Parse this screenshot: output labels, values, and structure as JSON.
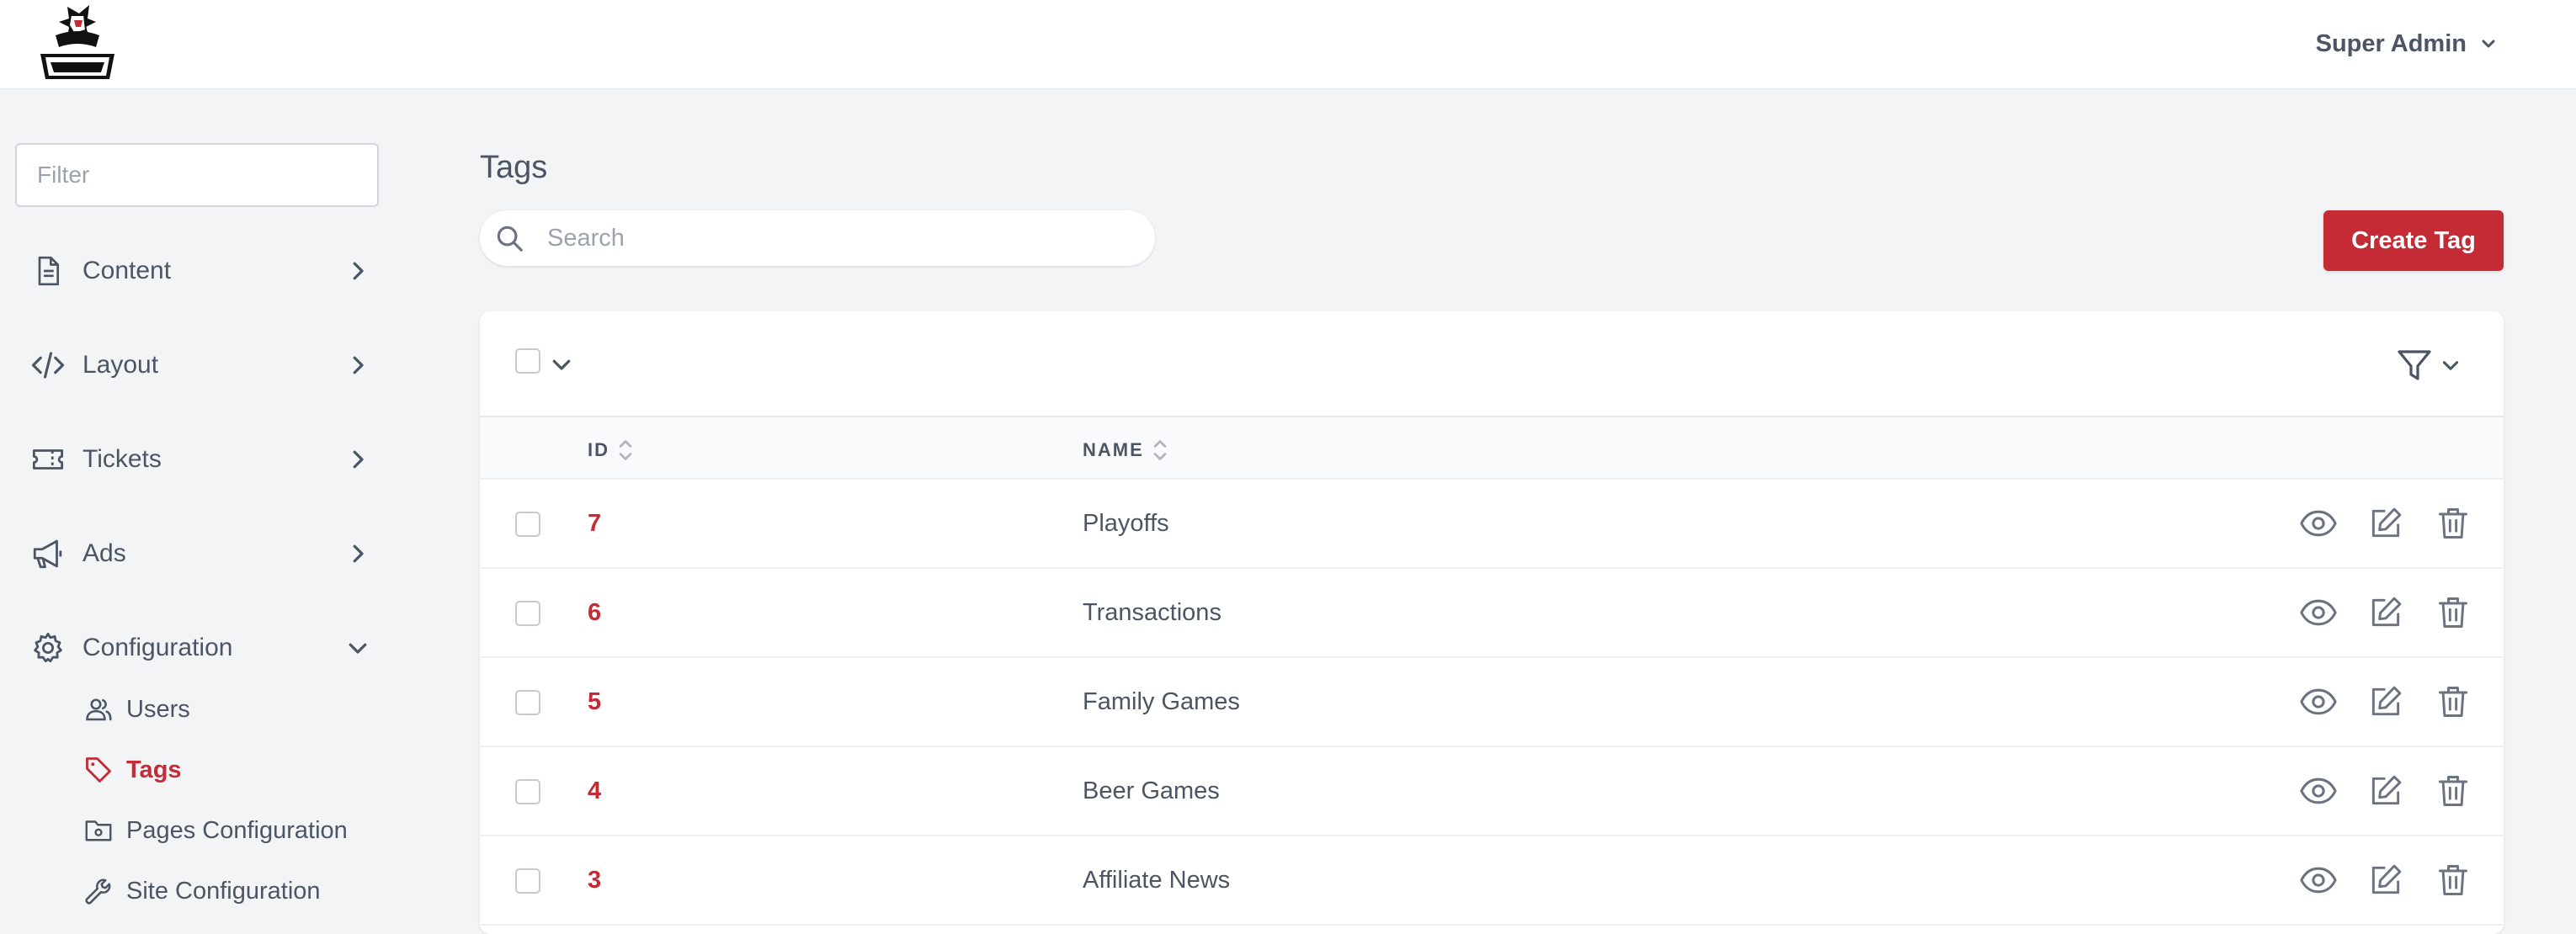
{
  "header": {
    "logo_alt": "Thunder",
    "user_menu_label": "Super Admin"
  },
  "sidebar": {
    "filter_placeholder": "Filter",
    "items": [
      {
        "label": "Content",
        "icon": "document-icon"
      },
      {
        "label": "Layout",
        "icon": "code-icon"
      },
      {
        "label": "Tickets",
        "icon": "ticket-icon"
      },
      {
        "label": "Ads",
        "icon": "megaphone-icon"
      },
      {
        "label": "Configuration",
        "icon": "gear-icon"
      }
    ],
    "sub_items": [
      {
        "label": "Users",
        "icon": "users-icon"
      },
      {
        "label": "Tags",
        "icon": "tag-icon",
        "active": true
      },
      {
        "label": "Pages Configuration",
        "icon": "folder-gear-icon"
      },
      {
        "label": "Site Configuration",
        "icon": "wrench-icon"
      }
    ]
  },
  "main": {
    "title": "Tags",
    "search_placeholder": "Search",
    "create_button_label": "Create Tag",
    "table": {
      "columns": [
        "ID",
        "NAME"
      ],
      "rows": [
        {
          "id": "7",
          "name": "Playoffs"
        },
        {
          "id": "6",
          "name": "Transactions"
        },
        {
          "id": "5",
          "name": "Family Games"
        },
        {
          "id": "4",
          "name": "Beer Games"
        },
        {
          "id": "3",
          "name": "Affiliate News"
        }
      ]
    }
  },
  "colors": {
    "accent": "#c52b34",
    "text": "#4b5563",
    "background": "#f3f4f6"
  }
}
